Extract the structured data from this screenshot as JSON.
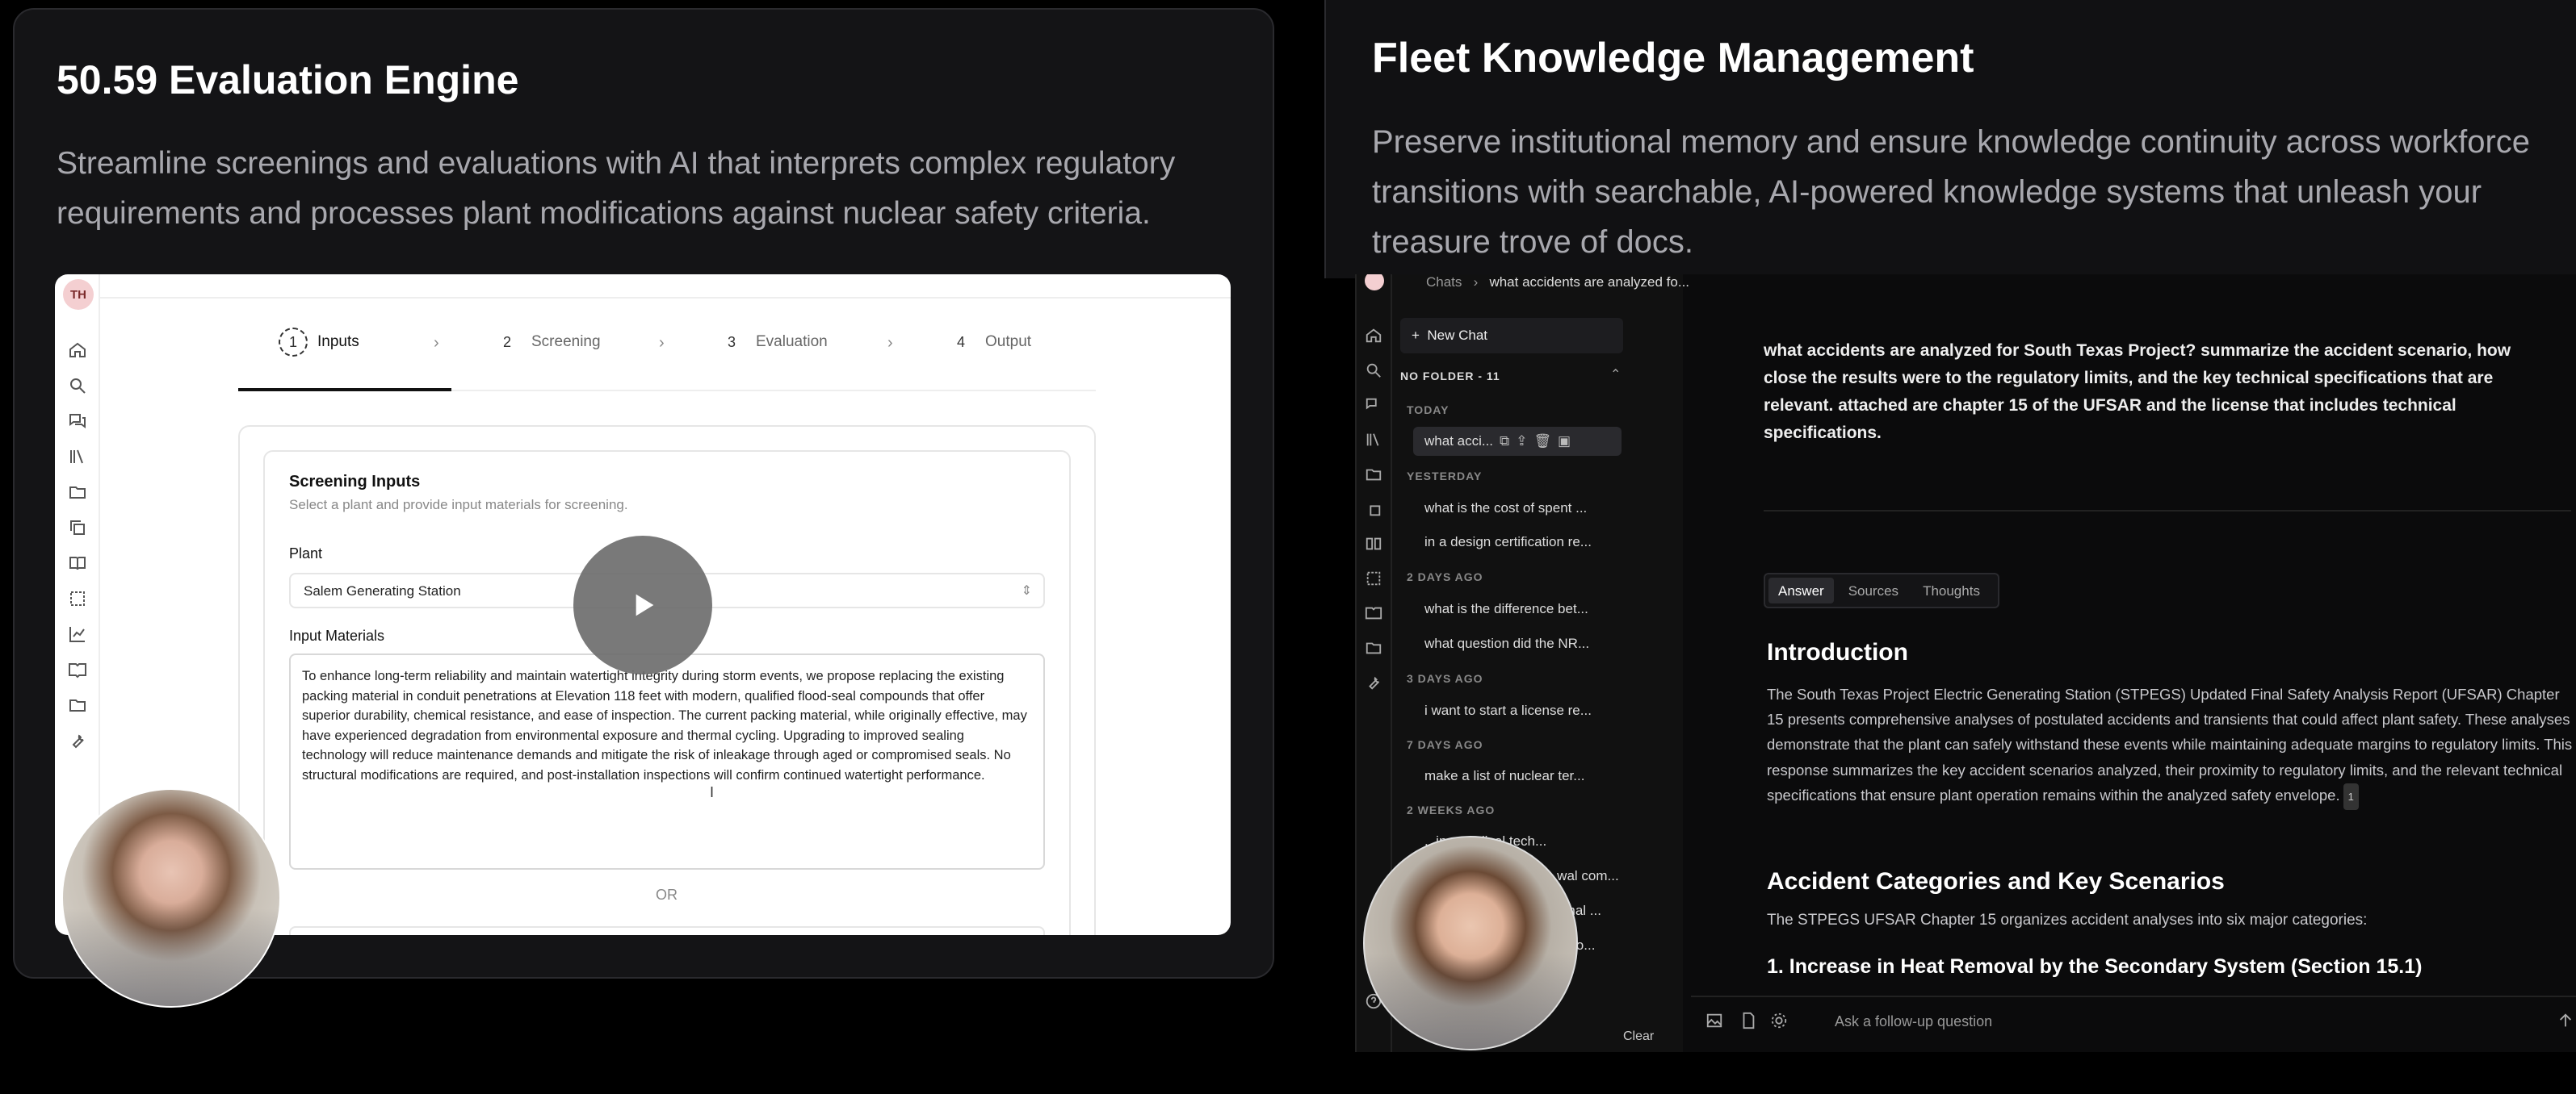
{
  "left_panel": {
    "title": "50.59 Evaluation Engine",
    "description": "Streamline screenings and evaluations with AI that interprets complex regulatory requirements and processes plant modifications against nuclear safety criteria.",
    "app": {
      "avatar_initials": "TH",
      "steps": [
        {
          "num": "1",
          "label": "Inputs"
        },
        {
          "num": "2",
          "label": "Screening"
        },
        {
          "num": "3",
          "label": "Evaluation"
        },
        {
          "num": "4",
          "label": "Output"
        }
      ],
      "card_title": "Screening Inputs",
      "card_subtitle": "Select a plant and provide input materials for screening.",
      "plant_label": "Plant",
      "plant_value": "Salem Generating Station",
      "input_label": "Input Materials",
      "input_text": "To enhance long-term reliability and maintain watertight integrity during storm events, we propose replacing the existing packing material in conduit penetrations at Elevation 118 feet with modern, qualified flood-seal compounds that offer superior durability, chemical resistance, and ease of inspection. The current packing material, while originally effective, may have experienced degradation from environmental exposure and thermal cycling. Upgrading to improved sealing technology will reduce maintenance demands and mitigate the risk of inleakage through aged or compromised seals. No structural modifications are required, and post-installation inspections will confirm continued watertight performance.",
      "or_label": "OR"
    }
  },
  "right_panel": {
    "title": "Fleet Knowledge Management",
    "description": "Preserve institutional memory and ensure knowledge continuity across workforce transitions with searchable, AI-powered knowledge systems that unleash your treasure trove of docs.",
    "app": {
      "breadcrumb": {
        "root": "Chats",
        "sep": "›",
        "current": "what accidents are analyzed fo..."
      },
      "new_chat": "New Chat",
      "folder_label": "NO FOLDER - 11",
      "groups": [
        {
          "label": "TODAY",
          "items": [
            "what acci..."
          ]
        },
        {
          "label": "YESTERDAY",
          "items": [
            "what is the cost of spent ...",
            "in a design certification re..."
          ]
        },
        {
          "label": "2 DAYS AGO",
          "items": [
            "what is the difference bet...",
            "what question did the NR..."
          ]
        },
        {
          "label": "3 DAYS AGO",
          "items": [
            "i want to start a license re..."
          ]
        },
        {
          "label": "7 DAYS AGO",
          "items": [
            "make a list of nuclear ter..."
          ]
        },
        {
          "label": "2 WEEKS AGO",
          "items": [
            "...ing medical tech...",
            "...wal com...",
            "...ginal ...",
            "...nt to..."
          ]
        }
      ],
      "clear_label": "Clear",
      "question": "what accidents are analyzed for South Texas Project? summarize the accident scenario, how close the results were to the regulatory limits, and the key technical specifications that are relevant. attached are chapter 15 of the UFSAR and the license that includes technical specifications.",
      "tabs": [
        "Answer",
        "Sources",
        "Thoughts"
      ],
      "h_intro": "Introduction",
      "p_intro": "The South Texas Project Electric Generating Station (STPEGS) Updated Final Safety Analysis Report (UFSAR) Chapter 15 presents comprehensive analyses of postulated accidents and transients that could affect plant safety. These analyses demonstrate that the plant can safely withstand these events while maintaining adequate margins to regulatory limits. This response summarizes the key accident scenarios analyzed, their proximity to regulatory limits, and the relevant technical specifications that ensure plant operation remains within the analyzed safety envelope.",
      "ref_num": "1",
      "h_cat": "Accident Categories and Key Scenarios",
      "p_cat": "The STPEGS UFSAR Chapter 15 organizes accident analyses into six major categories:",
      "h_sub": "1. Increase in Heat Removal by the Secondary System (Section 15.1)",
      "followup_placeholder": "Ask a follow-up question"
    }
  }
}
